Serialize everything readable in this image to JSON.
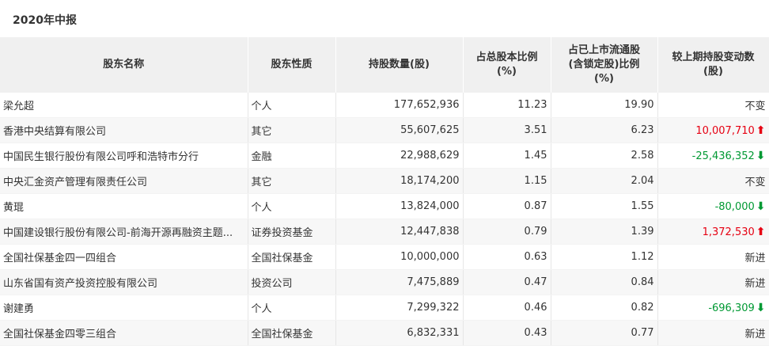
{
  "section_title": "2020年中报",
  "headers": {
    "name": "股东名称",
    "nature": "股东性质",
    "shares": "持股数量(股)",
    "total_ratio": "占总股本比例\n(%)",
    "float_ratio": "占已上市流通股\n(含锁定股)比例\n(%)",
    "change": "较上期持股变动数\n(股)"
  },
  "rows": [
    {
      "name": "梁允超",
      "nature": "个人",
      "shares": "177,652,936",
      "total_ratio": "11.23",
      "float_ratio": "19.90",
      "change": "不变",
      "trend": "flat",
      "icon": ""
    },
    {
      "name": "香港中央结算有限公司",
      "nature": "其它",
      "shares": "55,607,625",
      "total_ratio": "3.51",
      "float_ratio": "6.23",
      "change": "10,007,710",
      "trend": "up",
      "icon": "arrow-up-icon"
    },
    {
      "name": "中国民生银行股份有限公司呼和浩特市分行",
      "nature": "金融",
      "shares": "22,988,629",
      "total_ratio": "1.45",
      "float_ratio": "2.58",
      "change": "-25,436,352",
      "trend": "down",
      "icon": "arrow-down-icon"
    },
    {
      "name": "中央汇金资产管理有限责任公司",
      "nature": "其它",
      "shares": "18,174,200",
      "total_ratio": "1.15",
      "float_ratio": "2.04",
      "change": "不变",
      "trend": "flat",
      "icon": ""
    },
    {
      "name": "黄琨",
      "nature": "个人",
      "shares": "13,824,000",
      "total_ratio": "0.87",
      "float_ratio": "1.55",
      "change": "-80,000",
      "trend": "down",
      "icon": "arrow-down-icon"
    },
    {
      "name": "中国建设银行股份有限公司-前海开源再融资主题...",
      "nature": "证券投资基金",
      "shares": "12,447,838",
      "total_ratio": "0.79",
      "float_ratio": "1.39",
      "change": "1,372,530",
      "trend": "up",
      "icon": "arrow-up-icon"
    },
    {
      "name": "全国社保基金四一四组合",
      "nature": "全国社保基金",
      "shares": "10,000,000",
      "total_ratio": "0.63",
      "float_ratio": "1.12",
      "change": "新进",
      "trend": "flat",
      "icon": ""
    },
    {
      "name": "山东省国有资产投资控股有限公司",
      "nature": "投资公司",
      "shares": "7,475,889",
      "total_ratio": "0.47",
      "float_ratio": "0.84",
      "change": "新进",
      "trend": "flat",
      "icon": ""
    },
    {
      "name": "谢建勇",
      "nature": "个人",
      "shares": "7,299,322",
      "total_ratio": "0.46",
      "float_ratio": "0.82",
      "change": "-696,309",
      "trend": "down",
      "icon": "arrow-down-icon"
    },
    {
      "name": "全国社保基金四零三组合",
      "nature": "全国社保基金",
      "shares": "6,832,331",
      "total_ratio": "0.43",
      "float_ratio": "0.77",
      "change": "新进",
      "trend": "flat",
      "icon": ""
    }
  ],
  "colors": {
    "up": "#e60012",
    "down": "#009933",
    "header_bg": "#f0f0f0",
    "stripe_bg": "#f7f7f7"
  }
}
